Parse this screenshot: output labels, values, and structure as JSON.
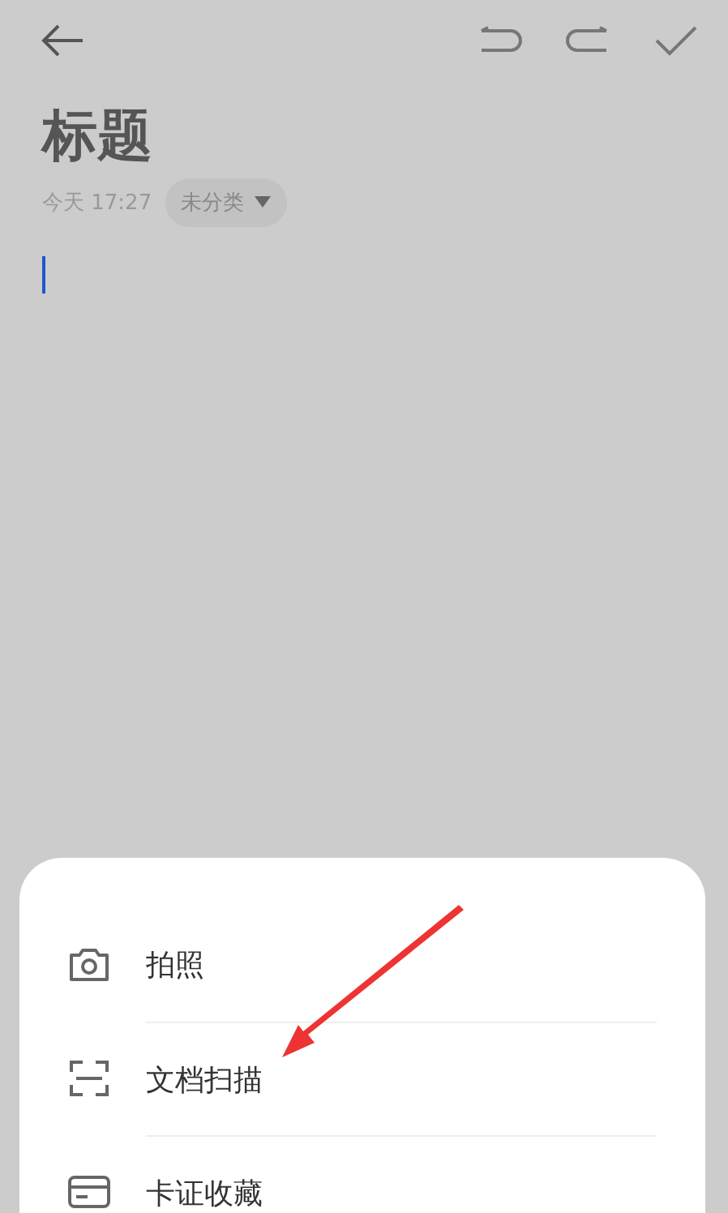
{
  "note": {
    "title": "标题",
    "date": "今天 17:27",
    "category": "未分类",
    "cursor": true
  },
  "sheet": {
    "items": [
      {
        "kind": "camera",
        "label": "拍照"
      },
      {
        "kind": "scan",
        "label": "文档扫描"
      },
      {
        "kind": "card",
        "label": "卡证收藏"
      }
    ]
  },
  "annotation": {
    "kind": "arrow",
    "color": "#ee3333"
  }
}
